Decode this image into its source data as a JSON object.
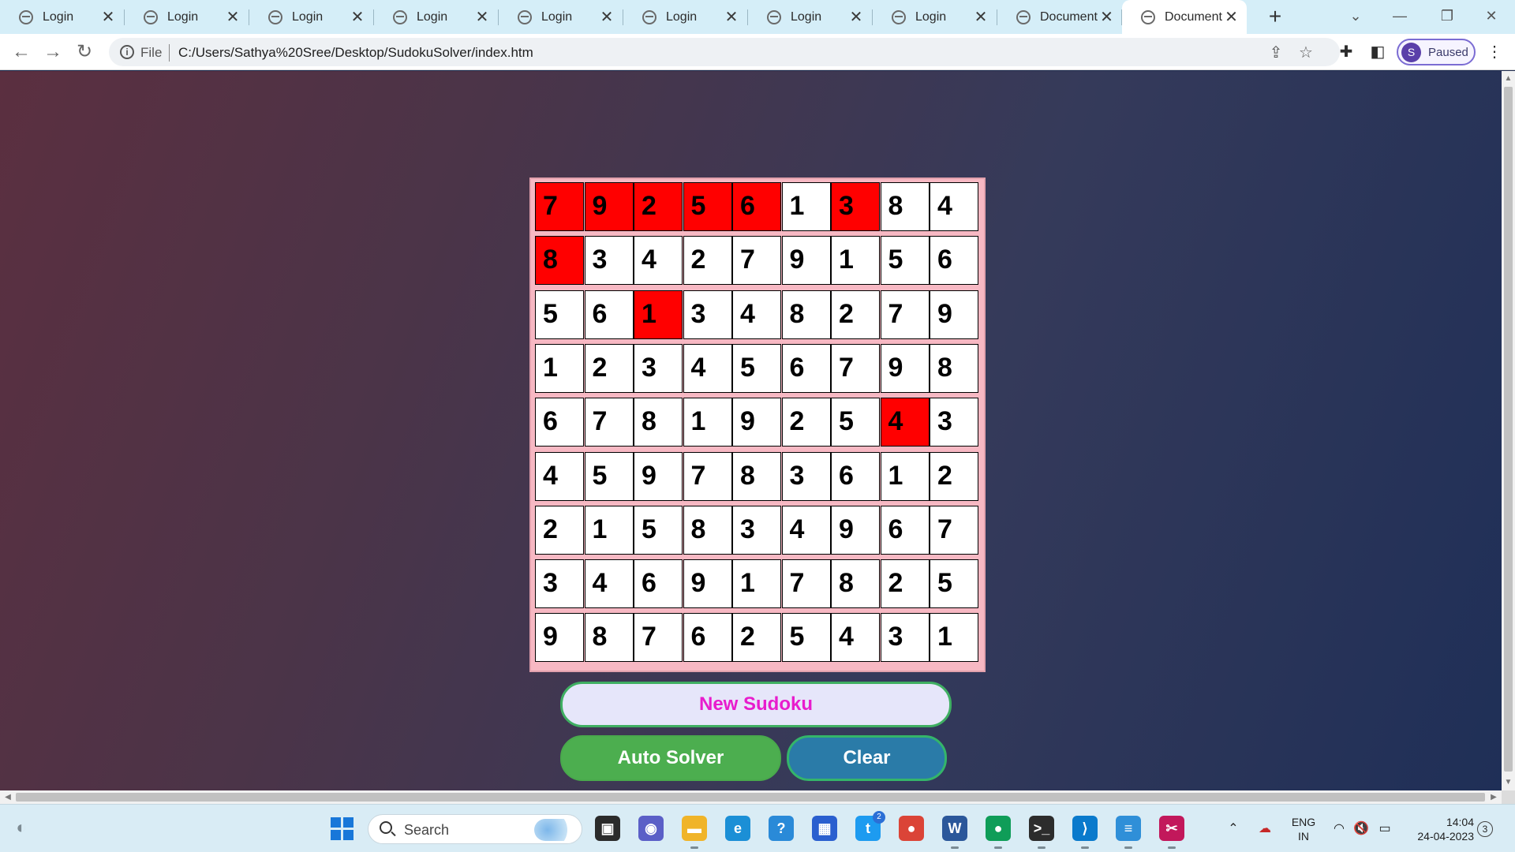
{
  "browser": {
    "tabs": [
      {
        "label": "Login"
      },
      {
        "label": "Login"
      },
      {
        "label": "Login"
      },
      {
        "label": "Login"
      },
      {
        "label": "Login"
      },
      {
        "label": "Login"
      },
      {
        "label": "Login"
      },
      {
        "label": "Login"
      },
      {
        "label": "Document"
      },
      {
        "label": "Document"
      }
    ],
    "active_tab_index": 9,
    "close_glyph": "✕",
    "new_tab_glyph": "+",
    "address": {
      "scheme": "File",
      "url": "C:/Users/Sathya%20Sree/Desktop/SudokuSolver/index.htm"
    },
    "profile": {
      "initial": "S",
      "status": "Paused"
    }
  },
  "sudoku": {
    "grid": [
      [
        7,
        9,
        2,
        5,
        6,
        1,
        3,
        8,
        4
      ],
      [
        8,
        3,
        4,
        2,
        7,
        9,
        1,
        5,
        6
      ],
      [
        5,
        6,
        1,
        3,
        4,
        8,
        2,
        7,
        9
      ],
      [
        1,
        2,
        3,
        4,
        5,
        6,
        7,
        9,
        8
      ],
      [
        6,
        7,
        8,
        1,
        9,
        2,
        5,
        4,
        3
      ],
      [
        4,
        5,
        9,
        7,
        8,
        3,
        6,
        1,
        2
      ],
      [
        2,
        1,
        5,
        8,
        3,
        4,
        9,
        6,
        7
      ],
      [
        3,
        4,
        6,
        9,
        1,
        7,
        8,
        2,
        5
      ],
      [
        9,
        8,
        7,
        6,
        2,
        5,
        4,
        3,
        1
      ]
    ],
    "highlighted": [
      [
        0,
        0
      ],
      [
        0,
        1
      ],
      [
        0,
        2
      ],
      [
        0,
        3
      ],
      [
        0,
        4
      ],
      [
        0,
        6
      ],
      [
        1,
        0
      ],
      [
        2,
        2
      ],
      [
        4,
        7
      ]
    ],
    "highlight_color": "#ff0000",
    "board_color": "#f7b8c3"
  },
  "buttons": {
    "new_sudoku": "New Sudoku",
    "auto_solver": "Auto Solver",
    "clear": "Clear"
  },
  "taskbar": {
    "search_placeholder": "Search",
    "apps": [
      {
        "name": "task-view-icon",
        "glyph": "▣",
        "color": "#2b2b2b",
        "running": false
      },
      {
        "name": "teams-chat-icon",
        "glyph": "◉",
        "color": "#5b5fc7",
        "running": false
      },
      {
        "name": "file-explorer-icon",
        "glyph": "▬",
        "color": "#f0b429",
        "running": true
      },
      {
        "name": "edge-icon",
        "glyph": "e",
        "color": "#1b8fd6",
        "running": false
      },
      {
        "name": "help-icon",
        "glyph": "?",
        "color": "#2a8ad8",
        "running": false
      },
      {
        "name": "store-icon",
        "glyph": "▦",
        "color": "#2a5fcf",
        "running": false
      },
      {
        "name": "twitter-icon",
        "glyph": "t",
        "color": "#1d9bf0",
        "running": false,
        "badge": "2"
      },
      {
        "name": "chrome-icon",
        "glyph": "●",
        "color": "#db4437",
        "running": false
      },
      {
        "name": "word-icon",
        "glyph": "W",
        "color": "#2b579a",
        "running": true
      },
      {
        "name": "chrome-profile-icon",
        "glyph": "●",
        "color": "#0f9d58",
        "running": true
      },
      {
        "name": "terminal-icon",
        "glyph": ">_",
        "color": "#2c2c2c",
        "running": true
      },
      {
        "name": "vscode-icon",
        "glyph": "⟩",
        "color": "#0a7acc",
        "running": true
      },
      {
        "name": "notepad-icon",
        "glyph": "≡",
        "color": "#2f8fd8",
        "running": true
      },
      {
        "name": "snipping-tool-icon",
        "glyph": "✂",
        "color": "#c2185b",
        "running": true
      }
    ],
    "language": {
      "line1": "ENG",
      "line2": "IN"
    },
    "time": "14:04",
    "date": "24-04-2023",
    "notifications": "3"
  }
}
